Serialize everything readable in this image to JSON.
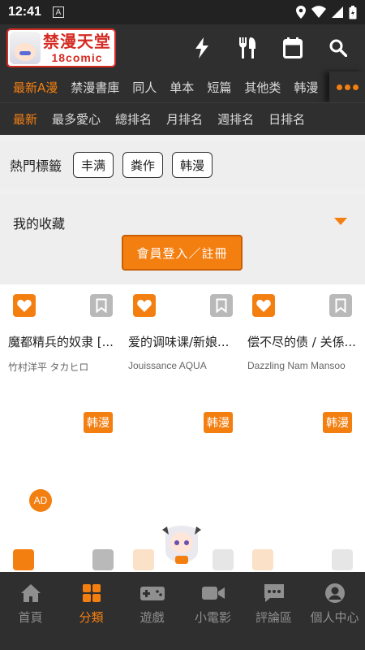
{
  "status_bar": {
    "time": "12:41",
    "notification": "A"
  },
  "app": {
    "logo_cn": "禁漫天堂",
    "logo_en": "18comic"
  },
  "category_tabs": [
    {
      "label": "最新A漫",
      "active": true
    },
    {
      "label": "禁漫書庫",
      "active": false
    },
    {
      "label": "同人",
      "active": false
    },
    {
      "label": "单本",
      "active": false
    },
    {
      "label": "短篇",
      "active": false
    },
    {
      "label": "其他类",
      "active": false
    },
    {
      "label": "韩漫",
      "active": false
    }
  ],
  "rank_tabs": [
    {
      "label": "最新",
      "active": true
    },
    {
      "label": "最多愛心",
      "active": false
    },
    {
      "label": "總排名",
      "active": false
    },
    {
      "label": "月排名",
      "active": false
    },
    {
      "label": "週排名",
      "active": false
    },
    {
      "label": "日排名",
      "active": false
    }
  ],
  "hot_tags": {
    "title": "熱門標籤",
    "tags": [
      "丰满",
      "粪作",
      "韩漫"
    ]
  },
  "favorites": {
    "title": "我的收藏",
    "login_button": "會員登入／註冊"
  },
  "comics": [
    {
      "title": "魔都精兵的奴隶 [...",
      "author": "竹村洋平 タカヒロ",
      "badge": "韩漫"
    },
    {
      "title": "爱的调味课/新娘...",
      "author": "Jouissance AQUA",
      "badge": "韩漫"
    },
    {
      "title": "偿不尽的债 / 关係...",
      "author": "Dazzling Nam Mansoo",
      "badge": "韩漫"
    }
  ],
  "ad_label": "AD",
  "bottom_nav": [
    {
      "label": "首頁",
      "icon": "home-icon",
      "active": false
    },
    {
      "label": "分類",
      "icon": "grid-icon",
      "active": true
    },
    {
      "label": "遊戲",
      "icon": "gamepad-icon",
      "active": false
    },
    {
      "label": "小電影",
      "icon": "video-icon",
      "active": false
    },
    {
      "label": "評論區",
      "icon": "comment-icon",
      "active": false
    },
    {
      "label": "個人中心",
      "icon": "user-icon",
      "active": false
    }
  ],
  "colors": {
    "accent": "#f47f11",
    "bar": "#2f2f2f",
    "status": "#222222"
  }
}
